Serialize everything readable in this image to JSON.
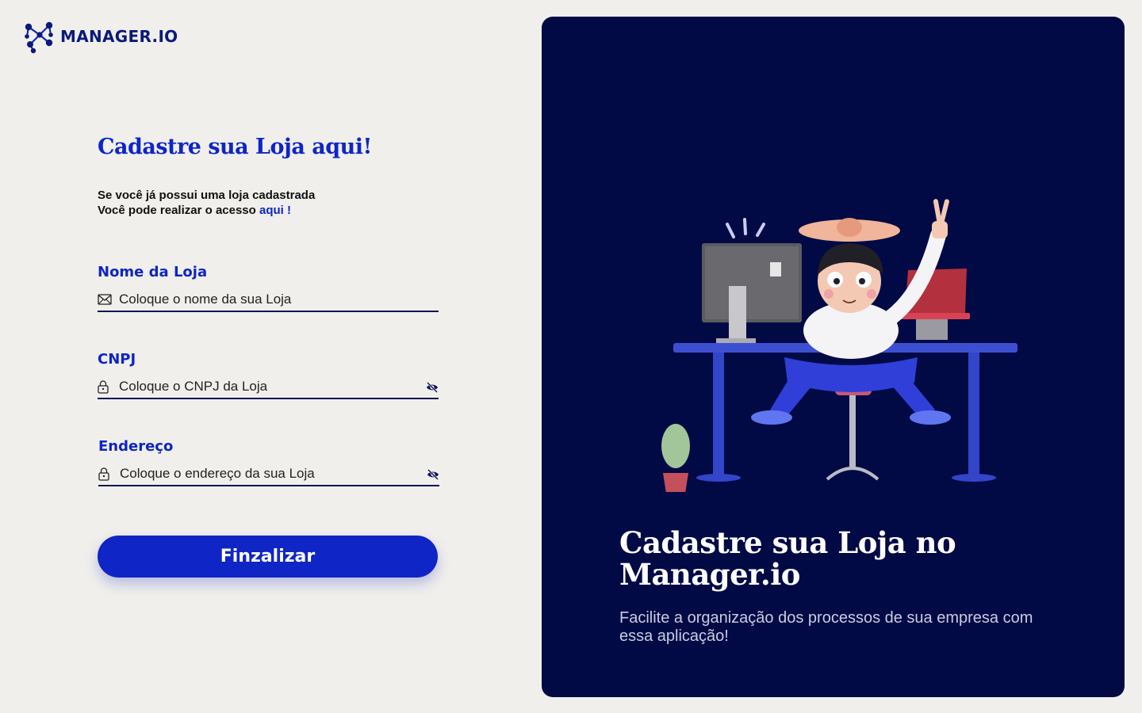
{
  "logo": {
    "text": "MANAGER.IO",
    "icon": "molecule-logo-icon"
  },
  "form": {
    "title": "Cadastre sua Loja aqui!",
    "intro_line1": "Se você já possui uma loja cadastrada",
    "intro_line2": "Você pode realizar o acesso ",
    "intro_link": "aqui !",
    "fields": [
      {
        "label": "Nome da Loja",
        "placeholder": "Coloque o nome da sua Loja",
        "value": "",
        "icon": "envelope-icon"
      },
      {
        "label": "CNPJ",
        "placeholder": "Coloque o CNPJ da Loja",
        "value": "",
        "icon": "lock-icon",
        "toggle_icon": "eye-off-icon"
      },
      {
        "label": "Endereço",
        "placeholder": "Coloque o endereço da sua Loja",
        "value": "",
        "icon": "lock-icon",
        "toggle_icon": "eye-off-icon"
      }
    ],
    "submit_label": "Finzalizar"
  },
  "panel": {
    "title": "Cadastre sua Loja no Manager.io",
    "subtitle": "Facilite a organização dos processos de sua empresa com essa aplicação!"
  },
  "colors": {
    "accent": "#0f25c6",
    "panel_bg": "#020a45",
    "page_bg": "#f0efec",
    "underline": "#0a1456"
  }
}
